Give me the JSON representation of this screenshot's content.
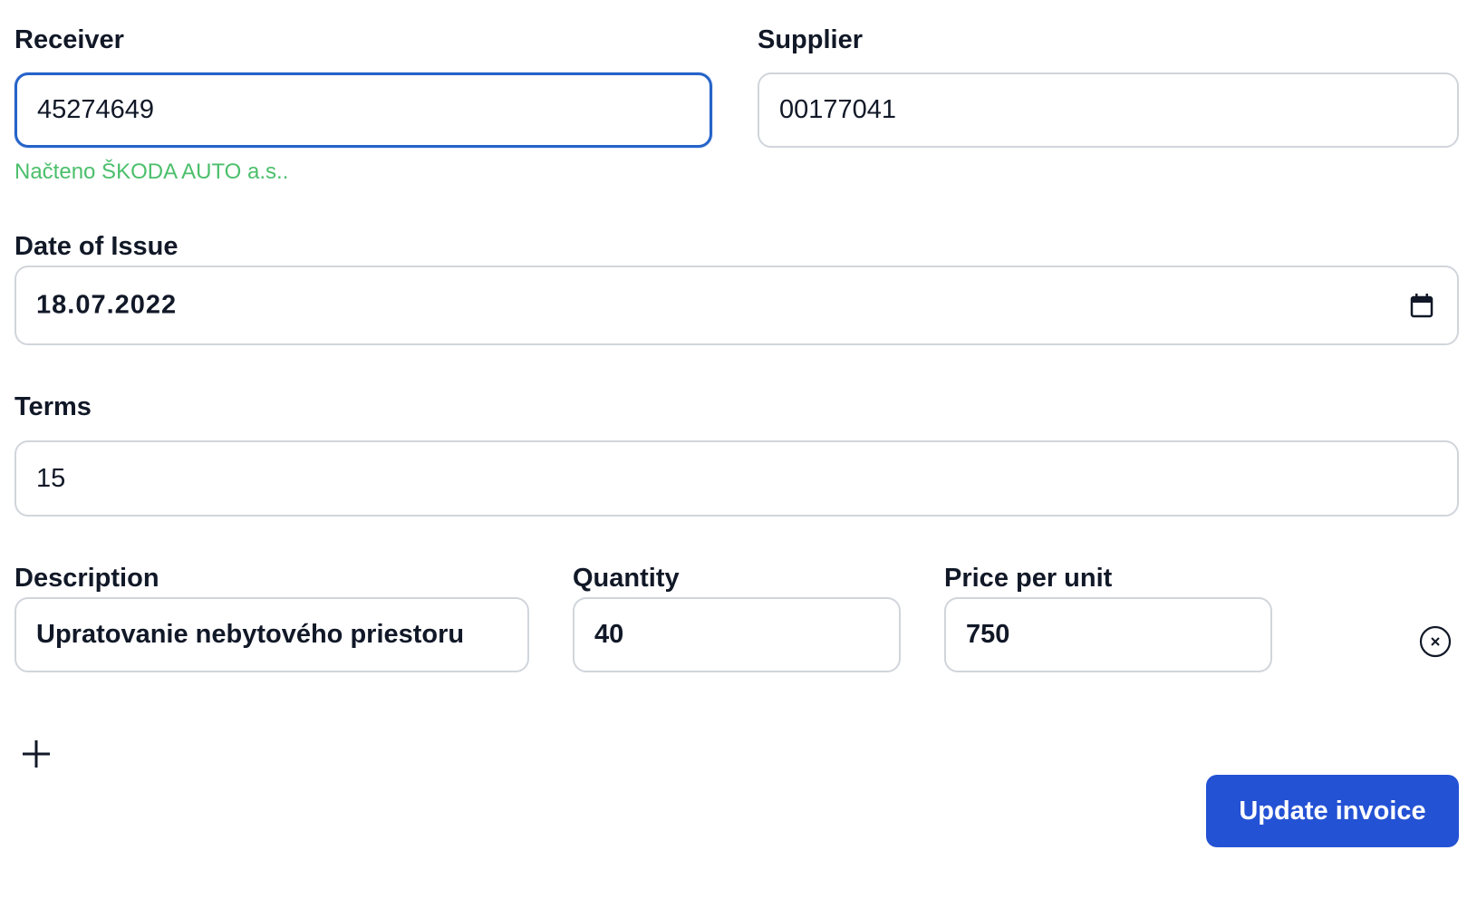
{
  "receiver": {
    "label": "Receiver",
    "value": "45274649",
    "hint": "Načteno ŠKODA AUTO a.s.."
  },
  "supplier": {
    "label": "Supplier",
    "value": "00177041"
  },
  "date_of_issue": {
    "label": "Date of Issue",
    "value": "18.07.2022",
    "icon": "calendar-icon"
  },
  "terms": {
    "label": "Terms",
    "value": "15"
  },
  "items": {
    "description_label": "Description",
    "quantity_label": "Quantity",
    "price_label": "Price per unit",
    "rows": [
      {
        "description": "Upratovanie nebytového priestoru",
        "quantity": "40",
        "price": "750",
        "remove_icon": "close-circle-icon"
      }
    ],
    "add_icon": "plus-icon"
  },
  "actions": {
    "submit_label": "Update invoice"
  },
  "colors": {
    "focus_border": "#2563c9",
    "hint_green": "#4bbf6b",
    "primary_button": "#2452d4"
  }
}
